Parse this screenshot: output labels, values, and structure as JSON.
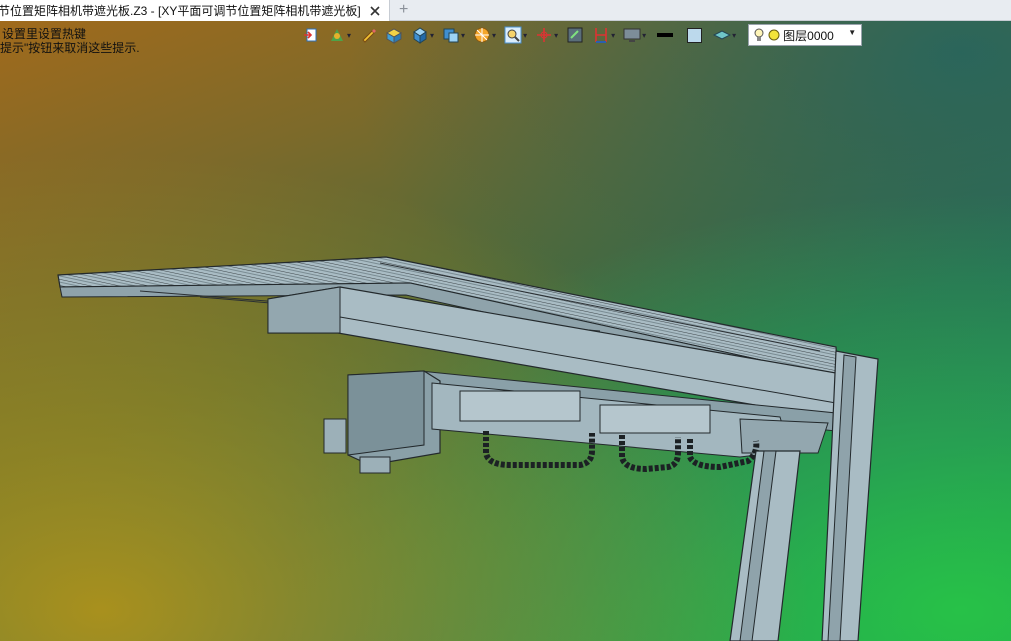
{
  "tabs": [
    {
      "title": "节位置矩阵相机带遮光板.Z3 - [XY平面可调节位置矩阵相机带遮光板]",
      "active": true
    }
  ],
  "new_tab_label": "+",
  "hint": {
    "line1": "设置里设置热键",
    "line2": "提示\"按钮来取消这些提示."
  },
  "toolbar": {
    "layer": {
      "label": "图层0000"
    },
    "icons": [
      "exit-sketch-icon",
      "view-icon",
      "pencil-icon",
      "box-icon",
      "cube-icon",
      "shaded-icon",
      "render-icon",
      "zoom-icon",
      "axis-icon",
      "fit-icon",
      "measure-icon",
      "display-icon",
      "line-color-icon",
      "fill-color-icon",
      "layer-style-icon",
      "bulb-icon"
    ]
  },
  "colors": {
    "model_fill": "#a9bcc4",
    "model_dark": "#7f959d",
    "edge": "#2a2f33"
  }
}
